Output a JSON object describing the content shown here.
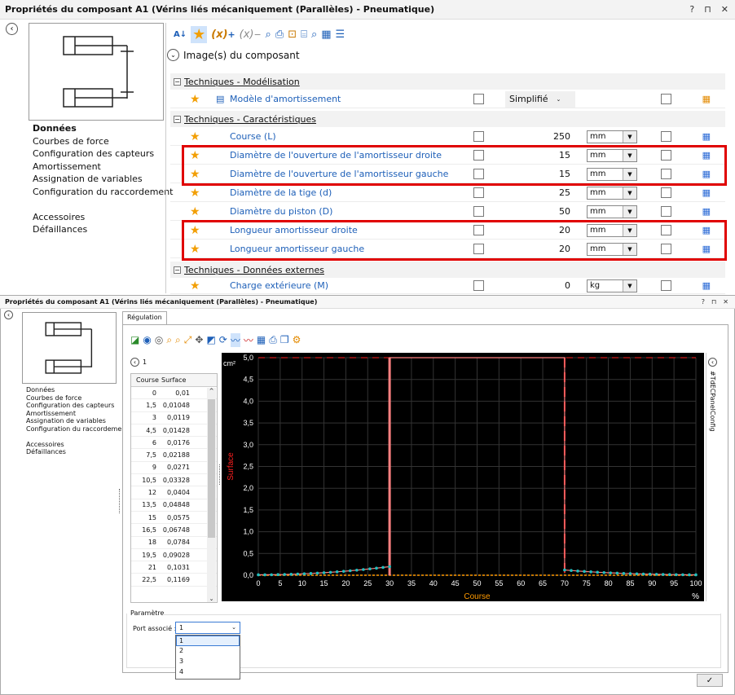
{
  "w1": {
    "title": "Propriétés du composant A1 (Vérins liés mécaniquement (Parallèles) - Pneumatique)",
    "window_controls": [
      "?",
      "⊓",
      "✕"
    ],
    "nav": [
      "Données",
      "Courbes de force",
      "Configuration des capteurs",
      "Amortissement",
      "Assignation de variables",
      "Configuration du raccordement",
      "",
      "Accessoires",
      "Défaillances"
    ],
    "image_header": "Image(s) du composant",
    "groups": [
      {
        "label": "Techniques - Modélisation"
      },
      {
        "label": "Techniques - Caractéristiques"
      },
      {
        "label": "Techniques - Données externes"
      }
    ],
    "model_row": {
      "name": "Modèle d'amortissement",
      "value": "Simplifié"
    },
    "rows": [
      {
        "name": "Course (L)",
        "value": "250",
        "unit": "mm"
      },
      {
        "name": "Diamètre de l'ouverture de l'amortisseur droite",
        "value": "15",
        "unit": "mm"
      },
      {
        "name": "Diamètre de l'ouverture de l'amortisseur gauche",
        "value": "15",
        "unit": "mm"
      },
      {
        "name": "Diamètre de la tige (d)",
        "value": "25",
        "unit": "mm"
      },
      {
        "name": "Diamètre du piston (D)",
        "value": "50",
        "unit": "mm"
      },
      {
        "name": "Longueur amortisseur droite",
        "value": "20",
        "unit": "mm"
      },
      {
        "name": "Longueur amortisseur gauche",
        "value": "20",
        "unit": "mm"
      }
    ],
    "ext_row": {
      "name": "Charge extérieure (M)",
      "value": "0",
      "unit": "kg"
    }
  },
  "w2": {
    "title": "Propriétés du composant A1 (Vérins liés mécaniquement (Parallèles) - Pneumatique)",
    "window_controls": [
      "?",
      "⊓",
      "✕"
    ],
    "tab": "Régulation",
    "nav": [
      "Données",
      "Courbes de force",
      "Configuration des capteurs",
      "Amortissement",
      "Assignation de variables",
      "Configuration du raccordement",
      "",
      "Accessoires",
      "Défaillances"
    ],
    "table_nav": "1",
    "table_headers": [
      "Course",
      "Surface"
    ],
    "table_rows": [
      [
        "0",
        "0,01"
      ],
      [
        "1,5",
        "0,01048"
      ],
      [
        "3",
        "0,0119"
      ],
      [
        "4,5",
        "0,01428"
      ],
      [
        "6",
        "0,0176"
      ],
      [
        "7,5",
        "0,02188"
      ],
      [
        "9",
        "0,0271"
      ],
      [
        "10,5",
        "0,03328"
      ],
      [
        "12",
        "0,0404"
      ],
      [
        "13,5",
        "0,04848"
      ],
      [
        "15",
        "0,0575"
      ],
      [
        "16,5",
        "0,06748"
      ],
      [
        "18",
        "0,0784"
      ],
      [
        "19,5",
        "0,09028"
      ],
      [
        "21",
        "0,1031"
      ],
      [
        "22,5",
        "0,1169"
      ]
    ],
    "side_tab": "#TdECPanelConfig",
    "param_label": "Paramètre",
    "port_label": "Port associé :",
    "port_value": "1",
    "port_options": [
      "1",
      "2",
      "3",
      "4"
    ],
    "ok": "✓"
  },
  "chart_data": {
    "type": "line",
    "xlabel": "Course",
    "ylabel": "Surface",
    "y_unit": "cm²",
    "x_unit": "%",
    "xlim": [
      0,
      100
    ],
    "ylim": [
      0,
      5
    ],
    "x_ticks": [
      "0",
      "5",
      "10",
      "15",
      "20",
      "25",
      "30",
      "35",
      "40",
      "45",
      "50",
      "55",
      "60",
      "65",
      "70",
      "75",
      "80",
      "85",
      "90",
      "95",
      "100"
    ],
    "y_ticks": [
      "0,0",
      "0,5",
      "1,0",
      "1,5",
      "2,0",
      "2,5",
      "3,0",
      "3,5",
      "4,0",
      "4,5",
      "5,0"
    ],
    "series": [
      {
        "x": [
          0,
          1.5,
          3,
          4.5,
          6,
          7.5,
          9,
          10.5,
          12,
          13.5,
          15,
          16.5,
          18,
          19.5,
          21,
          22.5,
          24,
          25.5,
          27,
          28.5,
          30,
          30,
          70,
          70,
          71.5,
          73,
          74.5,
          76,
          77.5,
          79,
          80.5,
          82,
          83.5,
          85,
          86.5,
          88,
          89.5,
          91,
          92.5,
          94,
          95.5,
          97,
          98.5,
          100
        ],
        "y": [
          0.01,
          0.01048,
          0.0119,
          0.01428,
          0.0176,
          0.02188,
          0.0271,
          0.03328,
          0.0404,
          0.04848,
          0.0575,
          0.06748,
          0.0784,
          0.09028,
          0.1031,
          0.1169,
          0.131,
          0.146,
          0.162,
          0.179,
          0.197,
          5,
          5,
          0.12,
          0.108,
          0.097,
          0.087,
          0.078,
          0.069,
          0.061,
          0.054,
          0.048,
          0.042,
          0.037,
          0.032,
          0.028,
          0.024,
          0.021,
          0.018,
          0.015,
          0.013,
          0.011,
          0.01,
          0.01
        ]
      }
    ],
    "markers_x": [
      30,
      70
    ],
    "colors": {
      "bg": "#000000",
      "curve": "#ff8080",
      "dots": "#20c0c0",
      "marker1": "#ff8080",
      "marker2": "#ff2020",
      "xaxis": "#ff9a00",
      "ylabel": "#ff2020"
    }
  }
}
